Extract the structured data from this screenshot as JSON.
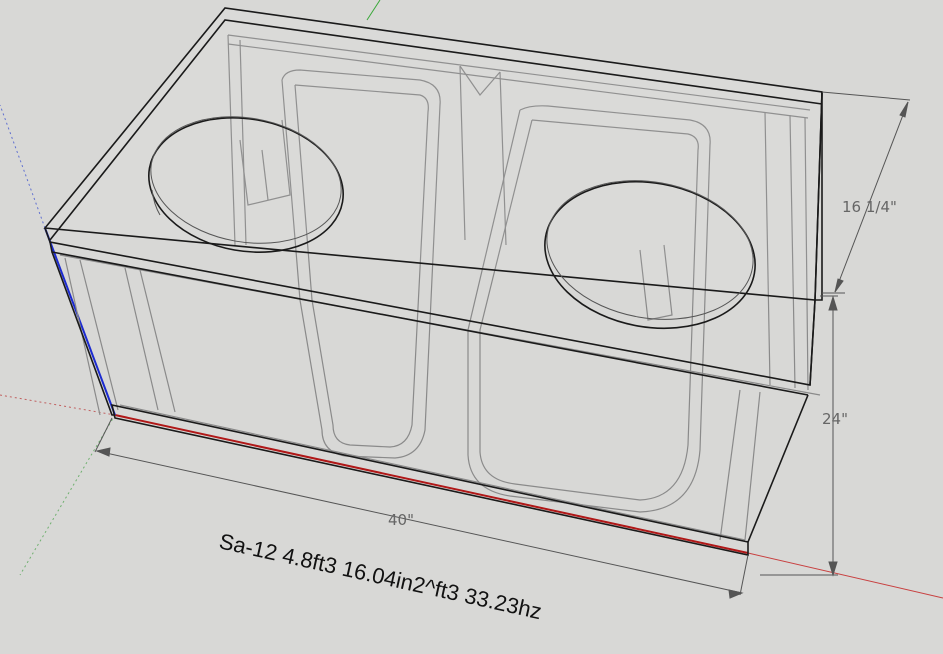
{
  "model": {
    "dimensions": {
      "width": "40\"",
      "height": "24\"",
      "depth": "16 1/4\""
    },
    "caption": "Sa-12 4.8ft3 16.04in2^ft3 33.23hz"
  },
  "colors": {
    "background": "#d8d8d6",
    "axis_red": "#b01818",
    "axis_green": "#3aa83a",
    "axis_blue": "#1c2bd0",
    "edge": "#1a1a1a",
    "hidden_edge": "#8a8a8a"
  }
}
